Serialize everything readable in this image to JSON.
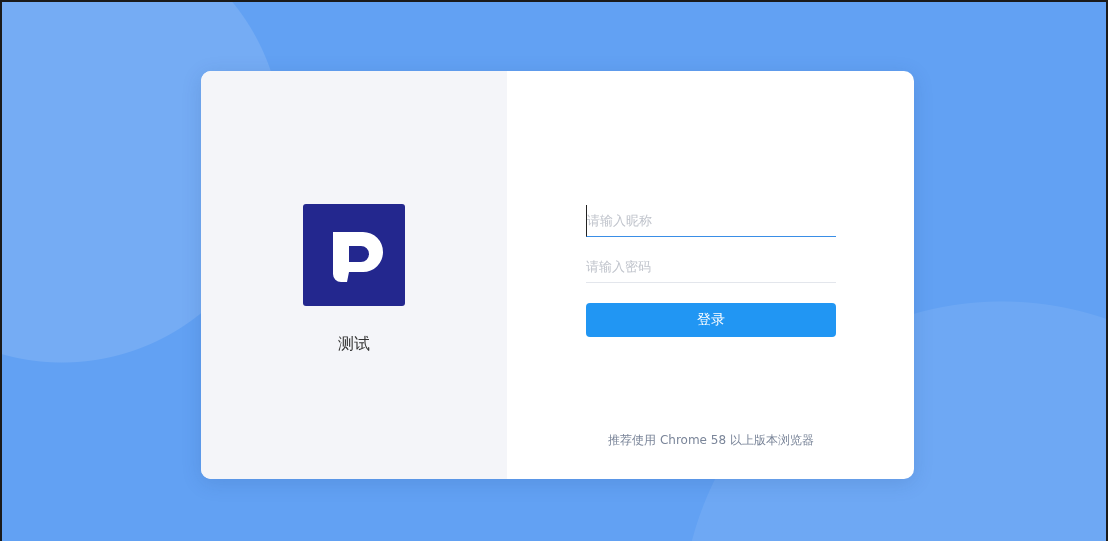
{
  "brand": {
    "name": "测试"
  },
  "fields": [
    {
      "placeholder": "请输入昵称",
      "focused": true
    },
    {
      "placeholder": "请输入密码",
      "focused": false
    }
  ],
  "submit": {
    "label": "登录"
  },
  "footer_note": "推荐使用 Chrome 58 以上版本浏览器"
}
